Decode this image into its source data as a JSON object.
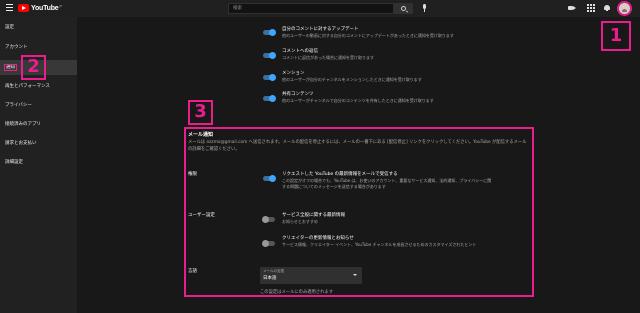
{
  "header": {
    "logo_text": "YouTube",
    "logo_country": "JP",
    "search_placeholder": "検索"
  },
  "sidebar": {
    "items": [
      {
        "label": "設定"
      },
      {
        "label": "アカウント"
      },
      {
        "label": "通知"
      },
      {
        "label": "再生とパフォーマンス"
      },
      {
        "label": "プライバシー"
      },
      {
        "label": "接続済みのアプリ"
      },
      {
        "label": "請求とお支払い"
      },
      {
        "label": "詳細設定"
      }
    ],
    "active_index": 2
  },
  "annotations": [
    "1",
    "2",
    "3"
  ],
  "top_settings": [
    {
      "title": "自分のコメントに対するアップデート",
      "desc": "他のユーザーの動画に対する自分のコメントにアップデートがあったときに通知を受け取ります",
      "enabled": true
    },
    {
      "title": "コメントへの返信",
      "desc": "コメントに返信があった場合に通知を受け取ります",
      "enabled": true
    },
    {
      "title": "メンション",
      "desc": "他のユーザーが自分のチャンネルをメンションしたときに通知を受け取ります",
      "enabled": true
    },
    {
      "title": "共有コンテンツ",
      "desc": "他のユーザーがチャンネルで自分のコンテンツを共有したときに通知を受け取ります",
      "enabled": true
    }
  ],
  "email": {
    "title": "メール通知",
    "desc": "メールは ozzmo@gmail.com へ送信されます。メールの配信を停止するには、メールの一番下にある [配信停止] リンクをクリックしてください。YouTube が配信するメールの詳細をご確認ください。",
    "permission_label": "権限",
    "permission_setting": {
      "title": "リクエストした YouTube の最新情報をメールで受信する",
      "desc1": "この設定がオフの場合でも、YouTube は、お使いのアカウント、重要なサービス通知、法的通知、プライバシーに関",
      "desc2": "する問題についてのメッセージを送信する場合があります",
      "enabled": true
    },
    "user_label": "ユーザー設定",
    "user_settings": [
      {
        "title": "サービス全般に関する最新情報",
        "desc": "お知らせとおすすめ",
        "enabled": false
      },
      {
        "title": "クリエイターの更新情報とお知らせ",
        "desc": "サービス情報、クリエイター イベント、YouTube チャンネルを成長させるためのカスタマイズされたヒント",
        "enabled": false
      }
    ],
    "language_label": "言語",
    "language_select_label": "メールの言語",
    "language_value": "日本語",
    "footnote": "この設定はメールにのみ適用されます"
  },
  "colors": {
    "accent": "#e91e8c",
    "toggle_on": "#3ea6ff",
    "logo_red": "#ff0000"
  }
}
